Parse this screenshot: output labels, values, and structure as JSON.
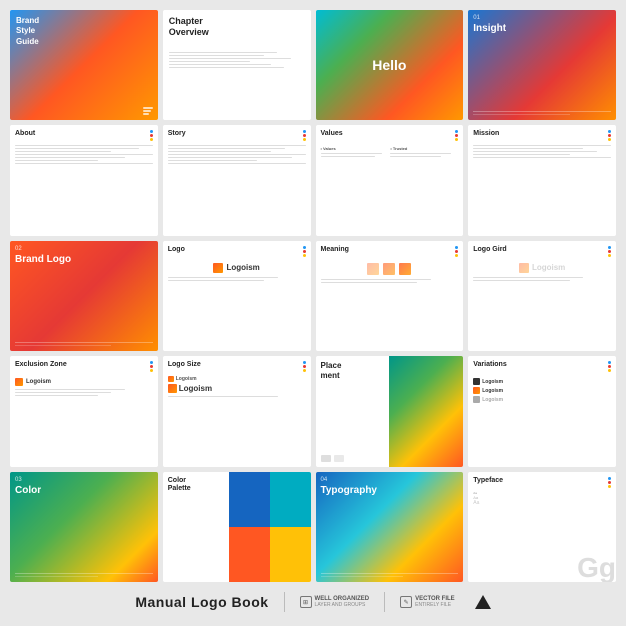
{
  "footer": {
    "title": "Manual Logo Book",
    "badge1": "WELL ORGANIZED",
    "badge1sub": "LAYER AND GROUPS",
    "badge2": "VECTOR FILE",
    "badge2sub": "ENTIRELY FILE"
  },
  "slides": [
    {
      "id": "brand-style-guide",
      "type": "gradient-bsg",
      "title": "Brand\nStyle\nGuide"
    },
    {
      "id": "chapter-overview",
      "type": "chapter",
      "title": "Chapter\nOverview"
    },
    {
      "id": "hello",
      "type": "gradient-hello",
      "text": "Hello"
    },
    {
      "id": "insight",
      "type": "gradient-insight",
      "num": "01",
      "title": "Insight"
    },
    {
      "id": "about",
      "type": "text",
      "title": "About"
    },
    {
      "id": "story",
      "type": "text",
      "title": "Story"
    },
    {
      "id": "values",
      "type": "text",
      "title": "Values"
    },
    {
      "id": "mission",
      "type": "text",
      "title": "Mission"
    },
    {
      "id": "brand-logo",
      "type": "gradient-section",
      "num": "02",
      "title": "Brand Logo"
    },
    {
      "id": "logo",
      "type": "logo-slide",
      "title": "Logo"
    },
    {
      "id": "meaning",
      "type": "meaning-slide",
      "title": "Meaning"
    },
    {
      "id": "logo-gird",
      "type": "logo-gird",
      "title": "Logo Gird"
    },
    {
      "id": "exclusion-zone",
      "type": "exclusion",
      "title": "Exclusion Zone"
    },
    {
      "id": "logo-size",
      "type": "logo-size",
      "title": "Logo Size"
    },
    {
      "id": "placement",
      "type": "placement",
      "title": "Place\nment"
    },
    {
      "id": "variations",
      "type": "variations",
      "title": "Variations"
    },
    {
      "id": "color",
      "type": "gradient-section",
      "num": "03",
      "title": "Color"
    },
    {
      "id": "color-palette",
      "type": "color-palette",
      "title": "Color\nPalette"
    },
    {
      "id": "typography",
      "type": "gradient-section-blue",
      "num": "04",
      "title": "Typography"
    },
    {
      "id": "typeface",
      "type": "typeface",
      "title": "Typeface"
    }
  ]
}
